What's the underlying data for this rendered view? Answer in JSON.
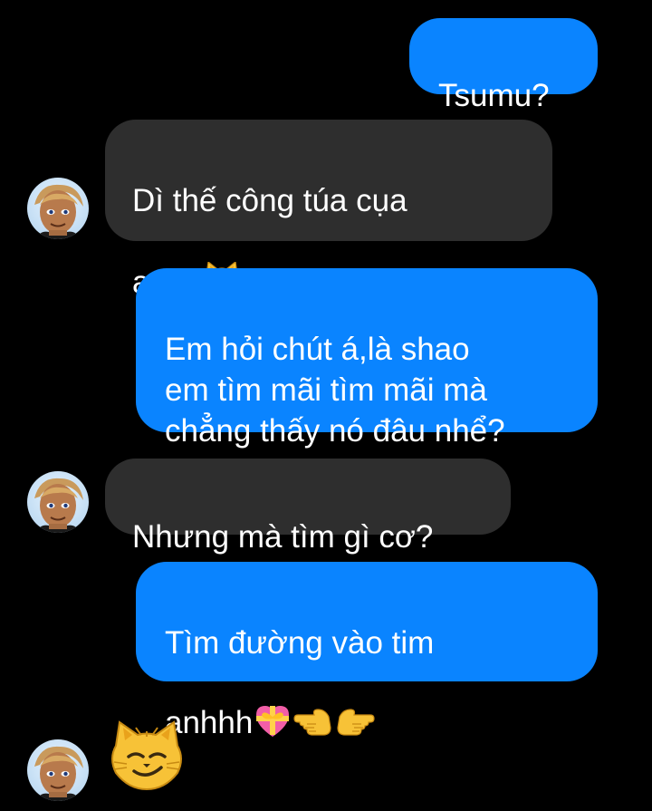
{
  "conversation": {
    "messages": [
      {
        "from": "me",
        "text": "Tsumu?"
      },
      {
        "from": "them",
        "text": "Dì thế công túa cụa\nanh?",
        "emoji": "smirk-cat"
      },
      {
        "from": "me",
        "text": "Em hỏi chút á,là shao\nem tìm mãi tìm mãi mà\nchẳng thấy nó đâu nhể?"
      },
      {
        "from": "them",
        "text": "Nhưng mà tìm gì cơ?"
      },
      {
        "from": "me",
        "text": "Tìm đường vào tim\nanhhh",
        "emoji": [
          "heart-with-ribbon",
          "pointing-left",
          "pointing-right"
        ]
      },
      {
        "from": "them",
        "emoji": "smirk-cat-large"
      }
    ]
  },
  "colors": {
    "background": "#000000",
    "outgoing_bubble": "#0a84ff",
    "incoming_bubble": "#2e2e2e",
    "text": "#ffffff"
  }
}
